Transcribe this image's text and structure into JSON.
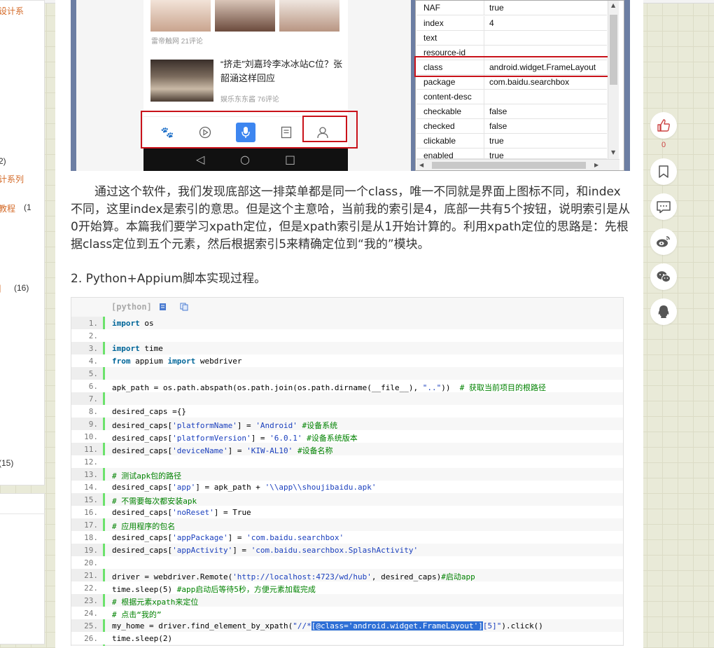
{
  "sidebar": {
    "items": [
      {
        "label": "设计系",
        "color": "orange"
      },
      {
        "label": "2)",
        "color": "dark"
      },
      {
        "label": "计系列",
        "color": "orange"
      },
      {
        "label": "教程",
        "color": "orange",
        "count": "(1"
      },
      {
        "label": "]",
        "color": "orange",
        "count": "(16)"
      },
      {
        "label": "(15)",
        "color": "dark"
      }
    ]
  },
  "screenshot": {
    "phone": {
      "meta1": "雷帝触网  21评论",
      "news_title": "“挤走”刘嘉玲李冰冰站C位？张韶涵这样回应",
      "meta2": "娱乐东东酱  76评论"
    },
    "properties": [
      {
        "key": "NAF",
        "value": "true"
      },
      {
        "key": "index",
        "value": "4"
      },
      {
        "key": "text",
        "value": ""
      },
      {
        "key": "resource-id",
        "value": ""
      },
      {
        "key": "class",
        "value": "android.widget.FrameLayout"
      },
      {
        "key": "package",
        "value": "com.baidu.searchbox"
      },
      {
        "key": "content-desc",
        "value": ""
      },
      {
        "key": "checkable",
        "value": "false"
      },
      {
        "key": "checked",
        "value": "false"
      },
      {
        "key": "clickable",
        "value": "true"
      },
      {
        "key": "enabled",
        "value": "true"
      }
    ]
  },
  "article": {
    "paragraph": "通过这个软件，我们发现底部这一排菜单都是同一个class，唯一不同就是界面上图标不同，和index不同，这里index是索引的意思。但是这个主意哈，当前我的索引是4，底部一共有5个按钮，说明索引是从0开始算。本篇我们要学习xpath定位，但是xpath索引是从1开始计算的。利用xpath定位的思路是：先根据class定位到五个元素，然后根据索引5来精确定位到“我的”模块。",
    "heading": "2. Python+Appium脚本实现过程。"
  },
  "code": {
    "language": "[python]",
    "lines": [
      {
        "n": "1.",
        "segments": [
          {
            "t": "import",
            "c": "kw"
          },
          {
            "t": " os",
            "c": ""
          }
        ]
      },
      {
        "n": "2.",
        "segments": []
      },
      {
        "n": "3.",
        "segments": [
          {
            "t": "import",
            "c": "kw"
          },
          {
            "t": " time",
            "c": ""
          }
        ]
      },
      {
        "n": "4.",
        "segments": [
          {
            "t": "from",
            "c": "kw"
          },
          {
            "t": " appium ",
            "c": ""
          },
          {
            "t": "import",
            "c": "kw"
          },
          {
            "t": " webdriver",
            "c": ""
          }
        ]
      },
      {
        "n": "5.",
        "segments": []
      },
      {
        "n": "6.",
        "segments": [
          {
            "t": "apk_path = os.path.abspath(os.path.join(os.path.dirname(__file__), ",
            "c": ""
          },
          {
            "t": "\"..\"",
            "c": "str"
          },
          {
            "t": "))  ",
            "c": ""
          },
          {
            "t": "# 获取当前项目的根路径",
            "c": "cm"
          }
        ]
      },
      {
        "n": "7.",
        "segments": []
      },
      {
        "n": "8.",
        "segments": [
          {
            "t": "desired_caps ={}",
            "c": ""
          }
        ]
      },
      {
        "n": "9.",
        "segments": [
          {
            "t": "desired_caps[",
            "c": ""
          },
          {
            "t": "'platformName'",
            "c": "str"
          },
          {
            "t": "] = ",
            "c": ""
          },
          {
            "t": "'Android'",
            "c": "str"
          },
          {
            "t": " ",
            "c": ""
          },
          {
            "t": "#设备系统",
            "c": "cm"
          }
        ]
      },
      {
        "n": "10.",
        "segments": [
          {
            "t": "desired_caps[",
            "c": ""
          },
          {
            "t": "'platformVersion'",
            "c": "str"
          },
          {
            "t": "] = ",
            "c": ""
          },
          {
            "t": "'6.0.1'",
            "c": "str"
          },
          {
            "t": " ",
            "c": ""
          },
          {
            "t": "#设备系统版本",
            "c": "cm"
          }
        ]
      },
      {
        "n": "11.",
        "segments": [
          {
            "t": "desired_caps[",
            "c": ""
          },
          {
            "t": "'deviceName'",
            "c": "str"
          },
          {
            "t": "] = ",
            "c": ""
          },
          {
            "t": "'KIW-AL10'",
            "c": "str"
          },
          {
            "t": " ",
            "c": ""
          },
          {
            "t": "#设备名称",
            "c": "cm"
          }
        ]
      },
      {
        "n": "12.",
        "segments": []
      },
      {
        "n": "13.",
        "segments": [
          {
            "t": "# 测试apk包的路径",
            "c": "cm"
          }
        ]
      },
      {
        "n": "14.",
        "segments": [
          {
            "t": "desired_caps[",
            "c": ""
          },
          {
            "t": "'app'",
            "c": "str"
          },
          {
            "t": "] = apk_path + ",
            "c": ""
          },
          {
            "t": "'\\\\app\\\\shoujibaidu.apk'",
            "c": "str"
          }
        ]
      },
      {
        "n": "15.",
        "segments": [
          {
            "t": "# 不需要每次都安装apk",
            "c": "cm"
          }
        ]
      },
      {
        "n": "16.",
        "segments": [
          {
            "t": "desired_caps[",
            "c": ""
          },
          {
            "t": "'noReset'",
            "c": "str"
          },
          {
            "t": "] = True",
            "c": ""
          }
        ]
      },
      {
        "n": "17.",
        "segments": [
          {
            "t": "# 应用程序的包名",
            "c": "cm"
          }
        ]
      },
      {
        "n": "18.",
        "segments": [
          {
            "t": "desired_caps[",
            "c": ""
          },
          {
            "t": "'appPackage'",
            "c": "str"
          },
          {
            "t": "] = ",
            "c": ""
          },
          {
            "t": "'com.baidu.searchbox'",
            "c": "str"
          }
        ]
      },
      {
        "n": "19.",
        "segments": [
          {
            "t": "desired_caps[",
            "c": ""
          },
          {
            "t": "'appActivity'",
            "c": "str"
          },
          {
            "t": "] = ",
            "c": ""
          },
          {
            "t": "'com.baidu.searchbox.SplashActivity'",
            "c": "str"
          }
        ]
      },
      {
        "n": "20.",
        "segments": []
      },
      {
        "n": "21.",
        "segments": [
          {
            "t": "driver = webdriver.Remote(",
            "c": ""
          },
          {
            "t": "'http://localhost:4723/wd/hub'",
            "c": "str"
          },
          {
            "t": ", desired_caps)",
            "c": ""
          },
          {
            "t": "#启动app",
            "c": "cm"
          }
        ]
      },
      {
        "n": "22.",
        "segments": [
          {
            "t": "time.sleep(5) ",
            "c": ""
          },
          {
            "t": "#app启动后等待5秒，方便元素加载完成",
            "c": "cm"
          }
        ]
      },
      {
        "n": "23.",
        "segments": [
          {
            "t": "# 根据元素xpath来定位",
            "c": "cm"
          }
        ]
      },
      {
        "n": "24.",
        "segments": [
          {
            "t": "# 点击“我的”",
            "c": "cm"
          }
        ]
      },
      {
        "n": "25.",
        "segments": [
          {
            "t": "my_home = driver.find_element_by_xpath(",
            "c": ""
          },
          {
            "t": "\"//*",
            "c": "str"
          },
          {
            "t": "[@class='android.widget.FrameLayout']",
            "c": "hl"
          },
          {
            "t": "[5]\"",
            "c": "str"
          },
          {
            "t": ").click()",
            "c": ""
          }
        ]
      },
      {
        "n": "26.",
        "segments": [
          {
            "t": "time.sleep(2)",
            "c": ""
          }
        ]
      }
    ]
  },
  "social": {
    "like_count": "0",
    "icons": [
      "thumbs-up-icon",
      "bookmark-icon",
      "comment-icon",
      "weibo-icon",
      "wechat-icon",
      "qq-icon"
    ]
  }
}
